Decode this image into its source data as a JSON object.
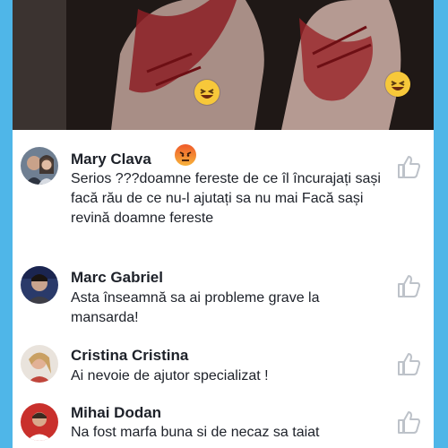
{
  "comments": [
    {
      "name": "Mary Clava",
      "text": "Serios ???doamne fereste de ce îl încurajați sași facă rău de ce nu-l ajutați sa nu mai Facă sași revină doamne fereste",
      "reaction_icon": "angry-reaction-icon"
    },
    {
      "name": "Marc Gabriel",
      "text": "Asta înseamnă sa ai probleme grave la mansarda!"
    },
    {
      "name": "Cristina Cristina",
      "text": "Ai nevoie de ajutor specializat !"
    },
    {
      "name": "Mihai Dodan",
      "text": "Na fost marfa buna si de necaz sa taiat"
    }
  ],
  "video": {
    "reactions": [
      "haha-reaction-icon",
      "haha-reaction-icon"
    ]
  },
  "colors": {
    "frame": "#4fb6e8",
    "reaction_yellow": "#f7c83a",
    "like_icon": "#bdc2c9",
    "name_text": "#1d2129"
  }
}
